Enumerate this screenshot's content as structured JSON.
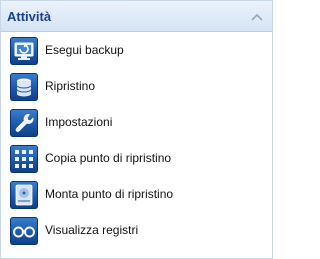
{
  "panel": {
    "title": "Attività",
    "collapse_icon": "chevron-up-icon",
    "accent_color": "#1b3f8f",
    "items": [
      {
        "label": "Esegui backup",
        "icon": "monitor-backup-icon"
      },
      {
        "label": "Ripristino",
        "icon": "database-restore-icon"
      },
      {
        "label": "Impostazioni",
        "icon": "wrench-icon"
      },
      {
        "label": "Copia punto di ripristino",
        "icon": "grid-copy-icon"
      },
      {
        "label": "Monta punto di ripristino",
        "icon": "hard-drive-mount-icon"
      },
      {
        "label": "Visualizza registri",
        "icon": "glasses-icon"
      }
    ]
  }
}
